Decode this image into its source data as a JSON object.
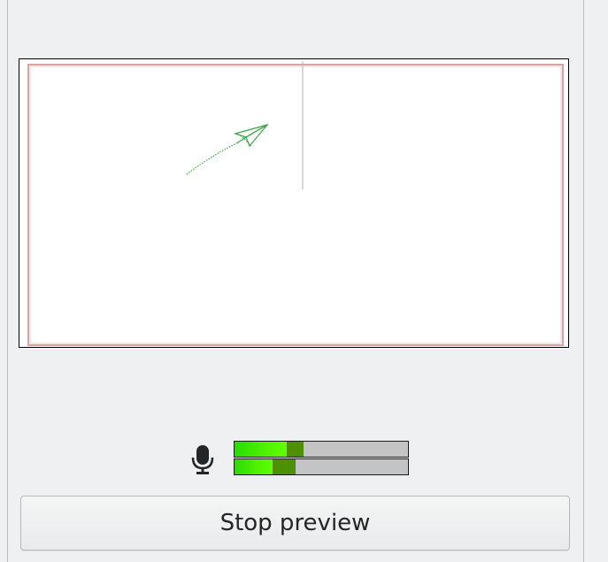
{
  "icons": {
    "microphone": "microphone-icon"
  },
  "audio_meter": {
    "channels": [
      {
        "level_percent": 30,
        "peak_percent": 40
      },
      {
        "level_percent": 22,
        "peak_percent": 35
      }
    ],
    "colors": {
      "fill": "#4df000",
      "peak": "#4d9000",
      "background": "#c4c4c4"
    }
  },
  "preview": {
    "colors": {
      "background": "#ffffff",
      "inner_border": "#d9a3a3",
      "arrow": "#3aa245"
    }
  },
  "buttons": {
    "stop_preview": "Stop preview"
  }
}
